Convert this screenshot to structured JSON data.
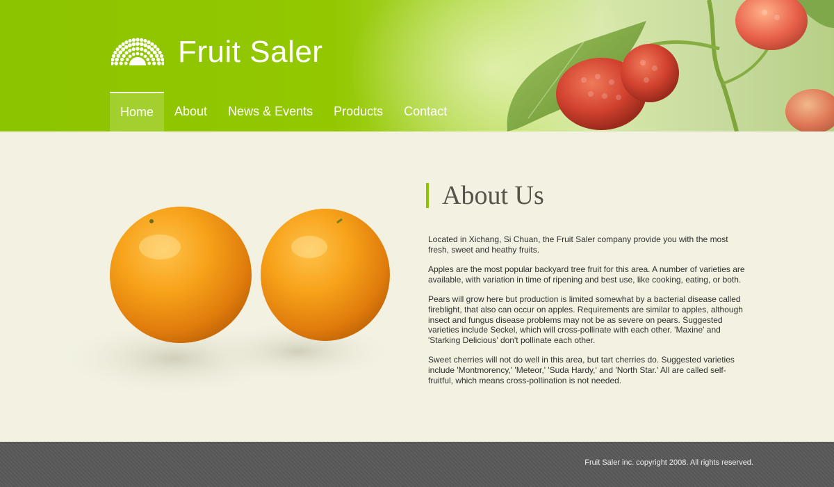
{
  "brand": {
    "title": "Fruit Saler",
    "logo_icon": "sunburst-dots-icon",
    "accent_color": "#8cc400"
  },
  "nav": {
    "items": [
      {
        "label": "Home",
        "active": true
      },
      {
        "label": "About",
        "active": false
      },
      {
        "label": "News & Events",
        "active": false
      },
      {
        "label": "Products",
        "active": false
      },
      {
        "label": "Contact",
        "active": false
      }
    ]
  },
  "about": {
    "title": "About Us",
    "paragraphs": [
      "Located in Xichang, Si Chuan, the Fruit Saler company provide you with the most fresh, sweet and heathy fruits.",
      "Apples are the most popular backyard tree fruit for this area. A number of varieties are available, with variation in time of ripening and best use, like cooking, eating, or both.",
      "Pears will grow here but production is limited somewhat by a bacterial disease called fireblight, that also can occur on apples. Requirements are similar to apples, although insect and fungus disease problems may not be as severe on pears. Suggested varieties include Seckel, which will cross-pollinate with each other. 'Maxine' and 'Starking Delicious' don't pollinate each other.",
      "Sweet cherries will not do well in this area, but tart cherries do. Suggested varieties include 'Montmorency,' 'Meteor,' 'Suda Hardy,' and 'North Star.' All are called self-fruitful, which means cross-pollination is not needed."
    ]
  },
  "images": {
    "hero": "oranges-photo",
    "header_decoration": "raspberry-branch-photo"
  },
  "footer": {
    "copyright": "Fruit Saler inc. copyright 2008. All rights reserved."
  }
}
